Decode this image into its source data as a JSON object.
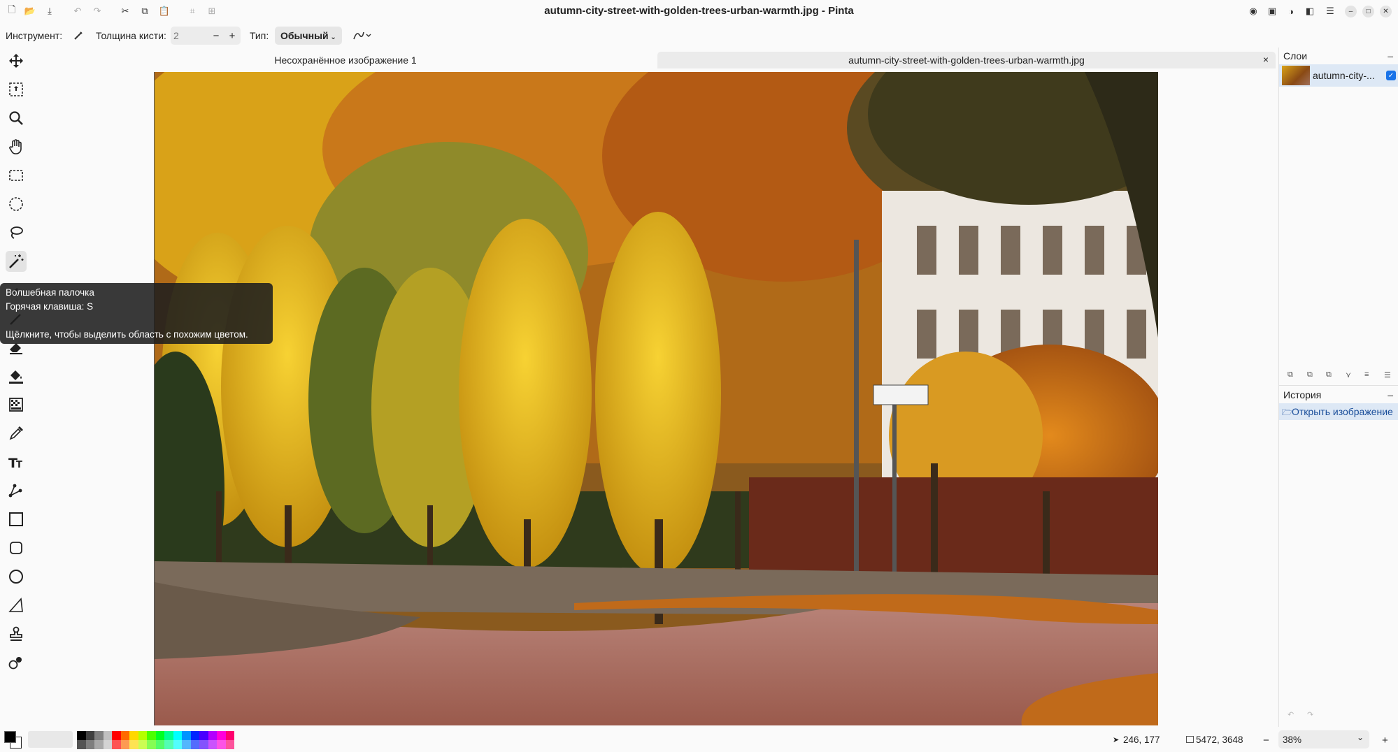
{
  "window": {
    "title": "autumn-city-street-with-golden-trees-urban-warmth.jpg - Pinta"
  },
  "toolbar_options": {
    "tool_label": "Инструмент:",
    "brush_width_label": "Толщина кисти:",
    "brush_width_value": "2",
    "minus": "−",
    "plus": "+",
    "type_label": "Тип:",
    "type_value": "Обычный"
  },
  "tabs": [
    {
      "label": "Несохранённое изображение 1"
    },
    {
      "label": "autumn-city-street-with-golden-trees-urban-warmth.jpg",
      "close": "×"
    }
  ],
  "tooltip": {
    "name": "Волшебная палочка",
    "hotkey": "Горячая клавиша: S",
    "description": "Щёлкните, чтобы выделить область с похожим цветом."
  },
  "tools": [
    "move-selected-icon",
    "move-selection-icon",
    "zoom-icon",
    "pan-icon",
    "rectangle-select-icon",
    "ellipse-select-icon",
    "lasso-select-icon",
    "magic-wand-icon",
    "paintbrush-icon",
    "pencil-icon",
    "eraser-icon",
    "paint-bucket-icon",
    "gradient-icon",
    "color-picker-icon",
    "text-icon",
    "line-curve-icon",
    "rectangle-icon",
    "rounded-rectangle-icon",
    "ellipse-icon",
    "freeform-shape-icon",
    "clone-stamp-icon",
    "recolor-icon"
  ],
  "layers_panel": {
    "title": "Слои",
    "minimize": "–",
    "layer_name": "autumn-city-..."
  },
  "history_panel": {
    "title": "История",
    "minimize": "–",
    "item": "Открыть изображение"
  },
  "status": {
    "cursor_pos": "246, 177",
    "image_size": "5472, 3648",
    "zoom_minus": "−",
    "zoom_value": "38%",
    "zoom_plus": "+"
  },
  "palette": [
    "#000000",
    "#404040",
    "#808080",
    "#c0c0c0",
    "#ff0000",
    "#ff6a00",
    "#ffd800",
    "#b6ff00",
    "#4cff00",
    "#00ff21",
    "#00ff90",
    "#00ffff",
    "#0094ff",
    "#0026ff",
    "#4800ff",
    "#b200ff",
    "#ff00dc",
    "#ff006e"
  ],
  "colors": {
    "accent": "#1a73e8",
    "selection": "#dde8f5"
  }
}
